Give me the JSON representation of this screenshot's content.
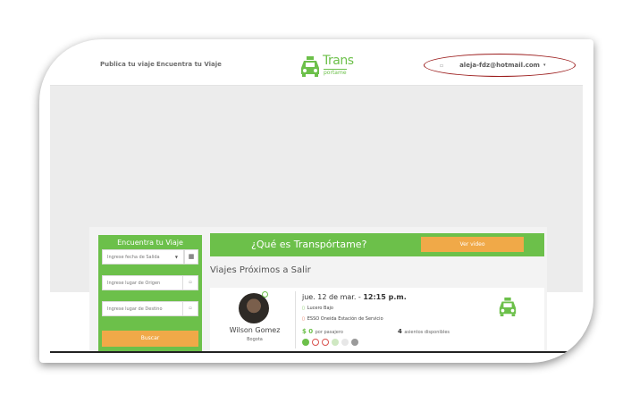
{
  "nav": {
    "publish_label": "Publica tu viaje",
    "find_label": "Encuentra tu Viaje",
    "user_email": "aleja-fdz@hotmail.com",
    "caret": "▾",
    "user_icon": "user-icon"
  },
  "logo": {
    "line1": "Trans",
    "line2": "portame",
    "icon": "taxi-icon"
  },
  "sidebar": {
    "title": "Encuentra tu Viaje",
    "date_placeholder": "Ingrese fecha de Salida",
    "origin_placeholder": "Ingrese lugar de Origen",
    "destination_placeholder": "Ingrese lugar de Destino",
    "search_label": "Buscar"
  },
  "banner": {
    "text": "¿Qué es Transpórtame?",
    "button_label": "Ver video"
  },
  "section": {
    "title": "Viajes Próximos a Salir"
  },
  "trip": {
    "driver_name": "Wilson Gomez",
    "driver_city": "Bogota",
    "date": "jue. 12 de mar. - ",
    "time": "12:15 p.m.",
    "origin": "Lucero Bajo",
    "destination": "ESSO Oneida Estación de Servicio",
    "price": "$ 0",
    "price_note": "por pasajero",
    "seats": "4",
    "seats_note": "asientos disponibles"
  },
  "colors": {
    "brand_green": "#6cc04a",
    "accent_orange": "#f0a948",
    "highlight_red": "#9b1b1b"
  }
}
